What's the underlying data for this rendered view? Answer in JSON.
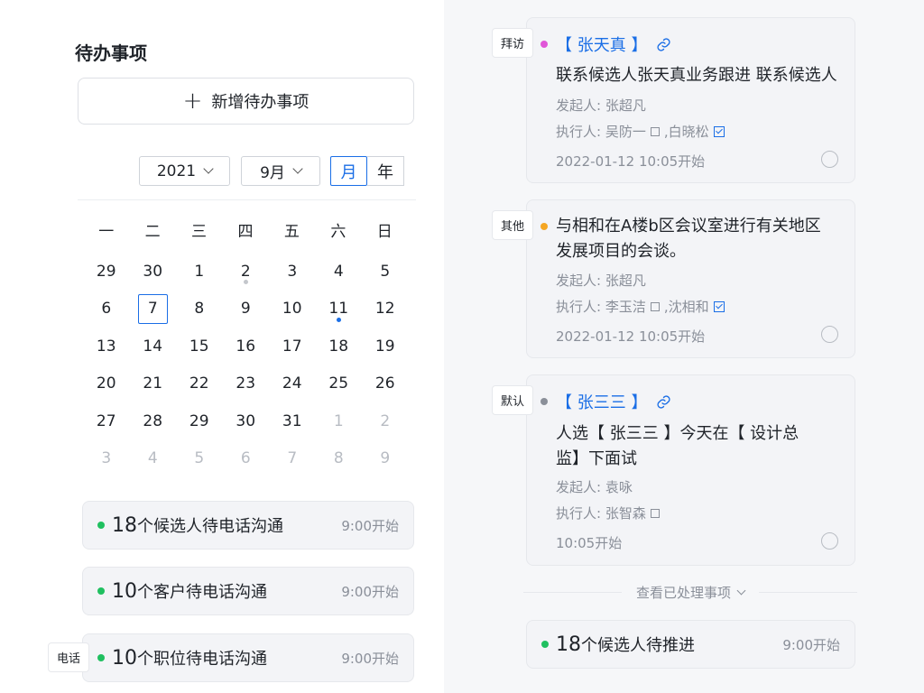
{
  "left": {
    "title": "待办事项",
    "add_button": {
      "icon": "plus-icon",
      "label": "新增待办事项"
    },
    "calendar": {
      "year": "2021",
      "month": "9月",
      "view_month": "月",
      "view_year": "年",
      "weekdays": [
        "一",
        "二",
        "三",
        "四",
        "五",
        "六",
        "日"
      ],
      "days": [
        {
          "d": "29",
          "out": false
        },
        {
          "d": "30",
          "out": false
        },
        {
          "d": "1",
          "out": false
        },
        {
          "d": "2",
          "out": false,
          "dot": "#c4c7cc"
        },
        {
          "d": "3",
          "out": false
        },
        {
          "d": "4",
          "out": false
        },
        {
          "d": "5",
          "out": false
        },
        {
          "d": "6",
          "out": false
        },
        {
          "d": "7",
          "out": false,
          "selected": true
        },
        {
          "d": "8",
          "out": false
        },
        {
          "d": "9",
          "out": false
        },
        {
          "d": "10",
          "out": false
        },
        {
          "d": "11",
          "out": false,
          "dot": "#1a6ee6"
        },
        {
          "d": "12",
          "out": false
        },
        {
          "d": "13",
          "out": false
        },
        {
          "d": "14",
          "out": false
        },
        {
          "d": "15",
          "out": false
        },
        {
          "d": "16",
          "out": false
        },
        {
          "d": "17",
          "out": false
        },
        {
          "d": "18",
          "out": false
        },
        {
          "d": "19",
          "out": false
        },
        {
          "d": "20",
          "out": false
        },
        {
          "d": "21",
          "out": false
        },
        {
          "d": "22",
          "out": false
        },
        {
          "d": "23",
          "out": false
        },
        {
          "d": "24",
          "out": false
        },
        {
          "d": "25",
          "out": false
        },
        {
          "d": "26",
          "out": false
        },
        {
          "d": "27",
          "out": false
        },
        {
          "d": "28",
          "out": false
        },
        {
          "d": "29",
          "out": false
        },
        {
          "d": "30",
          "out": false
        },
        {
          "d": "31",
          "out": false
        },
        {
          "d": "1",
          "out": true
        },
        {
          "d": "2",
          "out": true
        },
        {
          "d": "3",
          "out": true
        },
        {
          "d": "4",
          "out": true
        },
        {
          "d": "5",
          "out": true
        },
        {
          "d": "6",
          "out": true
        },
        {
          "d": "7",
          "out": true
        },
        {
          "d": "8",
          "out": true
        },
        {
          "d": "9",
          "out": true
        }
      ]
    },
    "tasks": [
      {
        "count": "18",
        "label": "个候选人待电话沟通",
        "time": "9:00开始"
      },
      {
        "count": "10",
        "label": "个客户待电话沟通",
        "time": "9:00开始"
      },
      {
        "count": "10",
        "label": "个职位待电话沟通",
        "time": "9:00开始",
        "tag": "电话"
      }
    ]
  },
  "right": {
    "cards": [
      {
        "tag": "拜访",
        "dot_color": "#e056d8",
        "link_title": "【 张天真 】",
        "text": [
          "联系候选人张天真业务跟进 联系候选人"
        ],
        "initiator": "发起人: 张超凡",
        "executor_prefix": "执行人: 吴防一",
        "executor_suffix": ",白晓松",
        "datetime": "2022-01-12   10:05开始"
      },
      {
        "tag": "其他",
        "dot_color": "#f5a623",
        "text": [
          "与相和在A楼b区会议室进行有关地区",
          "发展项目的会谈。"
        ],
        "initiator": "发起人:  张超凡",
        "executor_prefix": "执行人: 李玉洁",
        "executor_suffix": ",沈相和",
        "datetime": "2022-01-12   10:05开始"
      },
      {
        "tag": "默认",
        "dot_color": "#8a8f99",
        "link_title": "【 张三三 】",
        "text": [
          "人选【 张三三 】今天在【 设计总",
          "监】下面试"
        ],
        "initiator": "发起人: 袁咏",
        "executor_prefix": "执行人: 张智森",
        "executor_suffix": "",
        "datetime": "10:05开始"
      }
    ],
    "view_processed": "查看已处理事项",
    "bottom_task": {
      "count": "18",
      "label": "个候选人待推进",
      "time": "9:00开始"
    }
  }
}
